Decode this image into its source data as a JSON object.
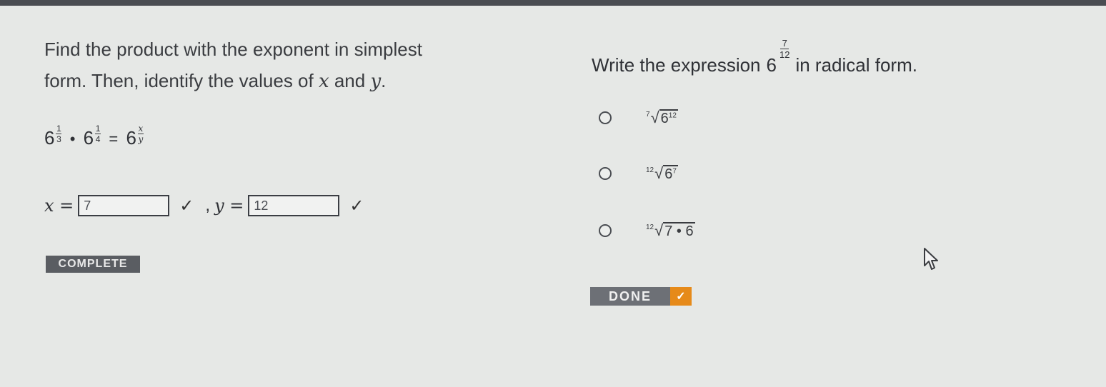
{
  "question_left": {
    "line1": "Find the product with the exponent in simplest",
    "line2_prefix": "form. Then, identify the values of ",
    "var_x": "x",
    "and": " and ",
    "var_y": "y",
    "period": ".",
    "equation": {
      "base": "6",
      "term1_num": "1",
      "term1_den": "3",
      "term2_num": "1",
      "term2_den": "4",
      "result_num": "x",
      "result_den": "y",
      "dot": "•",
      "equals": "="
    },
    "x_label": "x =",
    "x_value": "7",
    "separator": ",",
    "y_label": "y =",
    "y_value": "12",
    "check": "✓",
    "status_badge": "COMPLETE"
  },
  "question_right": {
    "prompt_before": "Write the expression",
    "base": "6",
    "exp_num": "7",
    "exp_den": "12",
    "prompt_after": "in radical form.",
    "options": [
      {
        "index": "7",
        "radicand_base": "6",
        "radicand_exp": "12"
      },
      {
        "index": "12",
        "radicand_base": "6",
        "radicand_exp": "7"
      },
      {
        "index": "12",
        "radicand": "7 • 6"
      }
    ],
    "done_label": "DONE",
    "done_check": "✓"
  },
  "colors": {
    "accent_orange": "#e68a1a",
    "badge_gray": "#5a5d62",
    "button_gray": "#6d7076"
  }
}
